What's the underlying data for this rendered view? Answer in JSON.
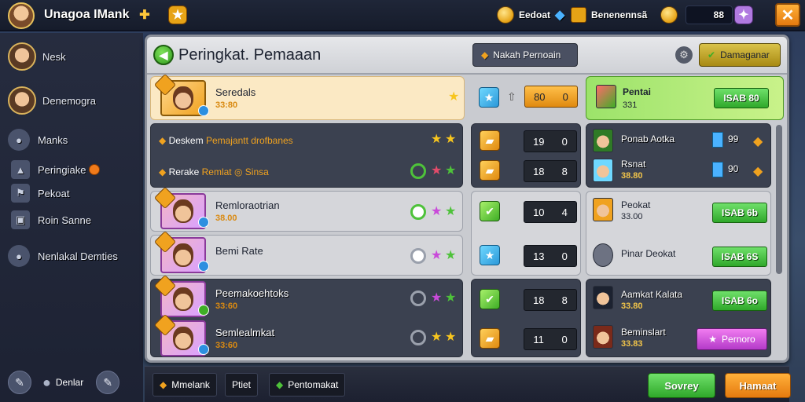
{
  "topbar": {
    "title": "Unagoa IMank",
    "currency1": "Eedoat",
    "currency2": "Benenennsã",
    "gold": "88"
  },
  "sidebar": {
    "items": [
      {
        "label": "Nesk"
      },
      {
        "label": "Denemogra"
      },
      {
        "label": "Manks"
      },
      {
        "label": "Peringiake"
      },
      {
        "label": "Pekoat"
      },
      {
        "label": "Roin Sanne"
      },
      {
        "label": "Nenlakal Demties"
      }
    ],
    "bottom_label": "Denlar"
  },
  "panel": {
    "title": "Peringkat. Pemaaan",
    "header_button": "Nakah Pernoain",
    "right_button": "Damaganar"
  },
  "featured": {
    "name": "Seredals",
    "sub": "33:80",
    "score": "80",
    "score2": "0",
    "right_name": "Pentai",
    "right_sub": "331",
    "right_button": "ISAB 80"
  },
  "group1": {
    "row1": {
      "label": "Deskem",
      "label_accent": "Pemajantt drofbanes"
    },
    "row2": {
      "label": "Rerake",
      "label_accent": "Remlat",
      "label_tail": "Sinsa"
    }
  },
  "rows": [
    {
      "name": "Remloraotrian",
      "sub": "38.00",
      "score": "10",
      "score2": "4"
    },
    {
      "name": "Bemi Rate",
      "sub": "",
      "score": "13",
      "score2": "0"
    },
    {
      "name": "Peemakoehtoks",
      "sub": "33:60",
      "score": "18",
      "score2": "8"
    },
    {
      "name": "Semlealmkat",
      "sub": "33:60",
      "score": "11",
      "score2": "0"
    }
  ],
  "mid_scores": [
    {
      "score": "19",
      "score2": "0"
    },
    {
      "score": "18",
      "score2": "8"
    }
  ],
  "right": [
    {
      "name": "Ponab Aotka",
      "value": "99",
      "sub": ""
    },
    {
      "name": "Rsnat",
      "sub": "38.80",
      "value": "90"
    },
    {
      "name": "Peokat",
      "sub": "33.00",
      "button": "ISAB 6b"
    },
    {
      "name": "Pinar Deokat",
      "button": "ISAB 6S"
    },
    {
      "name": "Aamkat Kalata",
      "sub": "33.80",
      "button": "ISAB 6o"
    },
    {
      "name": "Beminslart",
      "sub": "33.83",
      "button": "Pernoro"
    }
  ],
  "bottombar": {
    "tab1": "Mmelank",
    "tab2": "Ptiet",
    "tab3": "Pentomakat",
    "btn_green": "Sovrey",
    "btn_orange": "Hamaat"
  },
  "colors": {
    "accent_green": "#3fae26",
    "accent_orange": "#e57a0f",
    "accent_purple": "#b43ac9",
    "panel_bg": "#c9cbd0"
  }
}
